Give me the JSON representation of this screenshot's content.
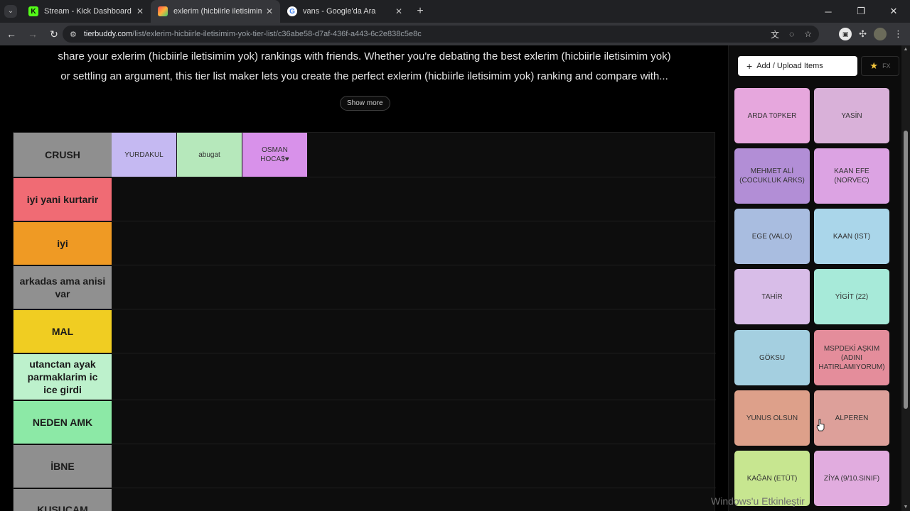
{
  "browser": {
    "tabs": [
      {
        "title": "Stream - Kick Dashboard",
        "favicon": "K",
        "favicon_color": "#53fc18",
        "active": false
      },
      {
        "title": "exlerim (hicbiirle iletisimim yok)",
        "favicon": "",
        "favicon_color": "#ff7f3f",
        "active": true
      },
      {
        "title": "vans - Google'da Ara",
        "favicon": "G",
        "favicon_color": "#ffffff",
        "active": false
      }
    ],
    "url_domain": "tierbuddy.com",
    "url_path": "/list/exlerim-hicbiirle-iletisimim-yok-tier-list/c36abe58-d7af-436f-a443-6c2e838c5e8c"
  },
  "page": {
    "description_line1": "share your exlerim (hicbiirle iletisimim yok) rankings with friends. Whether you're debating the best exlerim (hicbiirle iletisimim yok)",
    "description_line2": "or settling an argument, this tier list maker lets you create the perfect exlerim (hicbiirle iletisimim yok) ranking and compare with...",
    "show_more": "Show more"
  },
  "tiers": [
    {
      "label": "CRUSH",
      "color": "#8f8f8f",
      "items": [
        {
          "name": "YURDAKUL",
          "color": "#c5b9f2"
        },
        {
          "name": "abugat",
          "color": "#b6e8bb"
        },
        {
          "name": "OSMAN HOCA$♥",
          "color": "#d891ea"
        }
      ]
    },
    {
      "label": "iyi yani kurtarir",
      "color": "#f06b74",
      "items": []
    },
    {
      "label": "iyi",
      "color": "#ef9a24",
      "items": []
    },
    {
      "label": "arkadas ama anisi var",
      "color": "#909090",
      "items": []
    },
    {
      "label": "MAL",
      "color": "#f0cd22",
      "items": []
    },
    {
      "label": "utanctan ayak parmaklarim ic ice girdi",
      "color": "#bdf1cc",
      "items": []
    },
    {
      "label": "NEDEN AMK",
      "color": "#8ce9a6",
      "items": []
    },
    {
      "label": "İBNE",
      "color": "#8f8f8f",
      "items": []
    },
    {
      "label": "KUSUCAM",
      "color": "#8f8f8f",
      "items": []
    }
  ],
  "panel": {
    "add_button": "Add / Upload Items",
    "fx_label": "FX",
    "cards": [
      {
        "name": "ARDA T0PKER",
        "color": "#e6a7dd"
      },
      {
        "name": "YASİN",
        "color": "#d9b1d9"
      },
      {
        "name": "MEHMET ALİ (COCUKLUK ARKS)",
        "color": "#b28ed6"
      },
      {
        "name": "KAAN EFE (NORVEC)",
        "color": "#dca3e3"
      },
      {
        "name": "EGE (VALO)",
        "color": "#a9bde0"
      },
      {
        "name": "KAAN (IST)",
        "color": "#aad6ea"
      },
      {
        "name": "TAHİR",
        "color": "#d8bde8"
      },
      {
        "name": "YİGİT (22)",
        "color": "#a7ead9"
      },
      {
        "name": "GÖKSU",
        "color": "#a4cfe0"
      },
      {
        "name": "MSPDEKİ AŞKIM (ADINI HATIRLAMIYORUM)",
        "color": "#e48d9b"
      },
      {
        "name": "YUNUS OLSUN",
        "color": "#dda08a"
      },
      {
        "name": "ALPEREN",
        "color": "#dda09a"
      },
      {
        "name": "KAĞAN (ETÜT)",
        "color": "#c7e690"
      },
      {
        "name": "ZİYA (9/10.SINIF)",
        "color": "#e1acdf"
      }
    ]
  },
  "watermark": "Windows'u Etkinleştir"
}
